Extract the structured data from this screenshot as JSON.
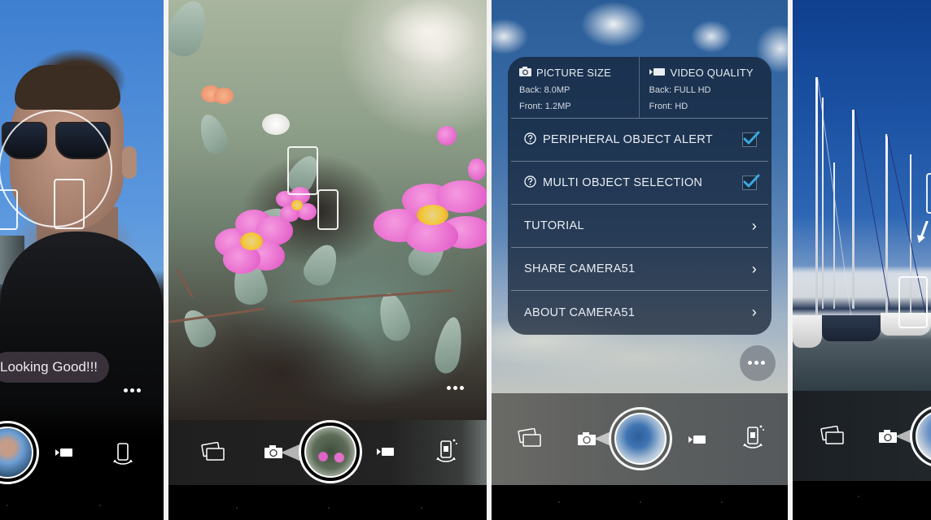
{
  "app": {
    "name": "Camera51"
  },
  "screens": [
    {
      "id": "selfie",
      "toast": "Looking Good!!!",
      "controls": [
        "shutter",
        "video-mode",
        "switch-camera"
      ]
    },
    {
      "id": "flowers",
      "controls": [
        "gallery",
        "photo-mode",
        "shutter",
        "video-mode",
        "switch-camera"
      ]
    },
    {
      "id": "settings",
      "settings": {
        "picture_size": {
          "title": "PICTURE SIZE",
          "back": "Back: 8.0MP",
          "front": "Front: 1.2MP"
        },
        "video_quality": {
          "title": "VIDEO QUALITY",
          "back": "Back: FULL HD",
          "front": "Front: HD"
        },
        "toggles": [
          {
            "label": "PERIPHERAL OBJECT ALERT",
            "checked": true
          },
          {
            "label": "MULTI OBJECT SELECTION",
            "checked": true
          }
        ],
        "links": [
          {
            "label": "TUTORIAL",
            "chevron": "›"
          },
          {
            "label": "SHARE CAMERA51",
            "chevron": "›"
          },
          {
            "label": "ABOUT CAMERA51",
            "chevron": "›"
          }
        ]
      },
      "controls": [
        "gallery",
        "photo-mode",
        "shutter",
        "video-mode",
        "switch-camera"
      ]
    },
    {
      "id": "marina",
      "controls": [
        "gallery",
        "photo-mode",
        "shutter"
      ]
    }
  ],
  "colors": {
    "checkbox_accent": "#3aa8e0",
    "panel_overlay": "#121e30",
    "flower_pink": "#e052c4",
    "divider": "#f4f4f4"
  }
}
